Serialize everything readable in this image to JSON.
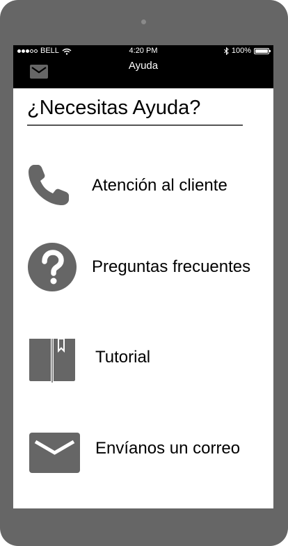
{
  "status_bar": {
    "carrier": "BELL",
    "time": "4:20 PM",
    "battery": "100%",
    "battery_level": 1.0,
    "signal_dots": 5,
    "signal_filled": 3
  },
  "nav": {
    "title": "Ayuda",
    "left_icon": "mail-icon"
  },
  "page": {
    "heading": "¿Necesitas Ayuda?"
  },
  "menu": [
    {
      "label": "Atención al cliente",
      "icon": "phone-icon"
    },
    {
      "label": "Preguntas frecuentes",
      "icon": "question-icon"
    },
    {
      "label": "Tutorial",
      "icon": "book-icon"
    },
    {
      "label": "Envíanos un correo",
      "icon": "mail-icon"
    }
  ],
  "colors": {
    "bezel": "#666666",
    "bar": "#000000",
    "icon": "#666666",
    "text": "#000000"
  }
}
